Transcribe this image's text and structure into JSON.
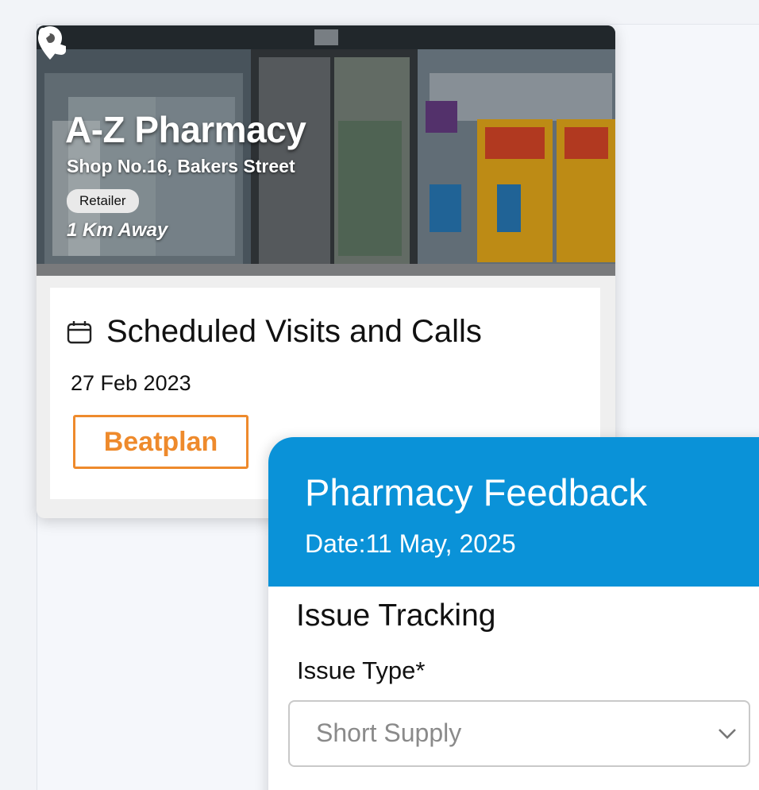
{
  "store": {
    "name": "A-Z Pharmacy",
    "address": "Shop No.16, Bakers Street",
    "type": "Retailer",
    "distance": "1 Km Away",
    "location_icon": "location-pin-icon",
    "phone_icon": "phone-icon"
  },
  "visits": {
    "title": "Scheduled Visits and Calls",
    "date": "27 Feb 2023",
    "beatplan_label": "Beatplan",
    "icon": "calendar-icon"
  },
  "feedback": {
    "title": "Pharmacy Feedback",
    "date": "Date:11 May, 2025",
    "section_title": "Issue Tracking",
    "issue_type_label": "Issue Type*",
    "issue_type_value": "Short Supply",
    "dropdown_icon": "chevron-down-icon"
  },
  "colors": {
    "accent_blue": "#0a92d8",
    "beatplan_orange": "#ee8a2c"
  }
}
